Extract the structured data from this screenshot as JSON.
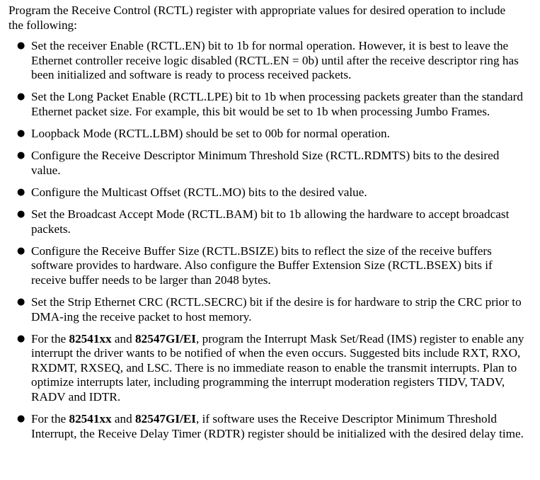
{
  "intro": "Program the Receive Control (RCTL) register with appropriate values for desired operation to include the following:",
  "bullets": [
    {
      "text": "Set the receiver Enable (RCTL.EN) bit to 1b for normal operation. However, it is best to leave the Ethernet controller receive logic disabled (RCTL.EN = 0b) until after the receive descriptor ring has been initialized and software is ready to process received packets."
    },
    {
      "text": "Set the Long Packet Enable (RCTL.LPE) bit to 1b when processing packets greater than the standard Ethernet packet size. For example, this bit would be set to 1b when processing Jumbo Frames."
    },
    {
      "text": "Loopback Mode (RCTL.LBM) should be set to 00b for normal operation."
    },
    {
      "text": "Configure the Receive Descriptor Minimum Threshold Size (RCTL.RDMTS) bits to the desired value."
    },
    {
      "text": "Configure the Multicast Offset (RCTL.MO) bits to the desired value."
    },
    {
      "text": "Set the Broadcast Accept Mode (RCTL.BAM) bit to 1b allowing the hardware to accept broadcast packets."
    },
    {
      "text": "Configure the Receive Buffer Size (RCTL.BSIZE) bits to reflect the size of the receive buffers software provides to hardware. Also configure the Buffer Extension Size (RCTL.BSEX) bits if receive buffer needs to be larger than 2048 bytes."
    },
    {
      "text": "Set the Strip Ethernet CRC (RCTL.SECRC) bit if the desire is for hardware to strip the CRC prior to DMA-ing the receive packet to host memory."
    },
    {
      "prefix": "For the ",
      "bold1": "82541xx",
      "mid": " and ",
      "bold2": "82547GI/EI",
      "rest": ", program the Interrupt Mask Set/Read (IMS) register to enable any interrupt the driver wants to be notified of when the even occurs. Suggested bits include RXT, RXO, RXDMT, RXSEQ, and LSC. There is no immediate reason to enable the transmit interrupts. Plan to optimize interrupts later, including programming the interrupt moderation registers TIDV, TADV, RADV and IDTR."
    },
    {
      "prefix": "For the ",
      "bold1": "82541xx",
      "mid": " and ",
      "bold2": "82547GI/EI",
      "rest": ", if software uses the Receive Descriptor Minimum Threshold Interrupt, the Receive Delay Timer (RDTR) register should be initialized with the desired delay time."
    }
  ]
}
